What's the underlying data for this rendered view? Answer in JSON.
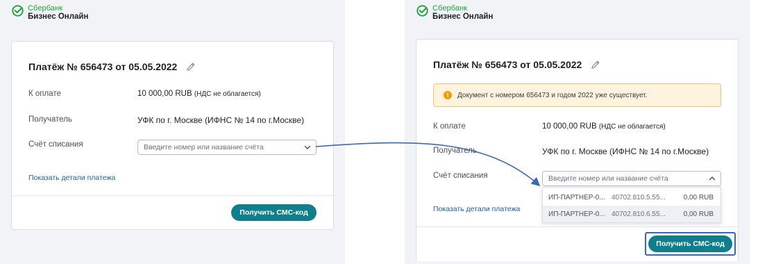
{
  "brand": {
    "name": "Сбербанк",
    "product": "Бизнес Онлайн"
  },
  "left": {
    "title": "Платёж № 656473 от 05.05.2022",
    "amount_label": "К оплате",
    "amount_value": "10 000,00 RUB",
    "amount_note": "(НДС не облагается)",
    "recipient_label": "Получатель",
    "recipient_value": "УФК по г. Москве (ИФНС № 14 по г.Москве)",
    "account_label": "Счёт списания",
    "account_placeholder": "Введите номер или название счёта",
    "details_link": "Показать детали платежа",
    "sms_button": "Получить СМС-код"
  },
  "right": {
    "title": "Платёж № 656473 от 05.05.2022",
    "warning_text": "Документ с номером 656473 и годом 2022 уже существует.",
    "amount_label": "К оплате",
    "amount_value": "10 000,00 RUB",
    "amount_note": "(НДС не облагается)",
    "recipient_label": "Получатель",
    "recipient_value": "УФК по г. Москве (ИФНС № 14 по г.Москве)",
    "account_label": "Счёт списания",
    "account_placeholder": "Введите номер или название счёта",
    "accounts": [
      {
        "name": "ИП-ПАРТНЕР-0...",
        "number": "40702.810.5.55...",
        "amount": "0,00 RUB"
      },
      {
        "name": "ИП-ПАРТНЕР-0...",
        "number": "40702.810.6.55...",
        "amount": "0,00 RUB"
      }
    ],
    "details_link": "Показать детали платежа",
    "sms_button": "Получить СМС-код"
  },
  "colors": {
    "brand_green": "#21a038",
    "button_teal": "#107f8c",
    "link_blue": "#1f5ea8",
    "arrow_blue": "#3769b5",
    "warning_orange": "#f29a00"
  }
}
